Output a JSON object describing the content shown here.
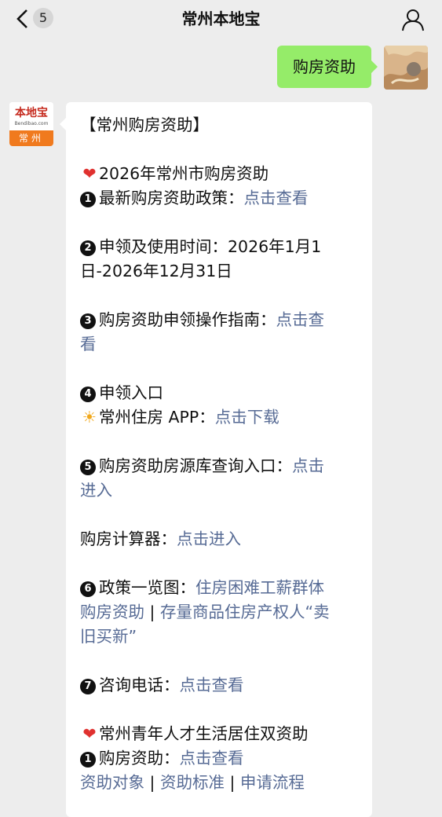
{
  "header": {
    "badge_count": "5",
    "title": "常州本地宝"
  },
  "sent_message": {
    "text": "购房资助"
  },
  "account_avatar": {
    "logo_text": "本地宝",
    "logo_sub": "Bendibao.com",
    "city": "常州"
  },
  "article": {
    "title": "【常州购房资助】",
    "section1_title": "2026年常州市购房资助",
    "item1_label": "最新购房资助政策：",
    "item1_link": "点击查看",
    "item2_line1": "申领及使用时间：2026年1月1",
    "item2_line2": "日-2026年12月31日",
    "item3_label": "购房资助申领操作指南：",
    "item3_link_part1": "点击查",
    "item3_link_part2": "看",
    "item4_label": "申领入口",
    "item4_app_label": "常州住房 APP：",
    "item4_app_link": "点击下载",
    "item5_label": "购房资助房源库查询入口：",
    "item5_link_part1": "点击",
    "item5_link_part2": "进入",
    "calc_label": "购房计算器：",
    "calc_link": "点击进入",
    "item6_label": "政策一览图：",
    "item6_link1_part1": "住房困难工薪群体",
    "item6_link1_part2": "购房资助",
    "sep": " | ",
    "item6_link2_part1": "存量商品住房产权人“卖",
    "item6_link2_part2": "旧买新”",
    "item7_label": "咨询电话：",
    "item7_link": "点击查看",
    "section2_title": "常州青年人才生活居住双资助",
    "s2_item1_label": "购房资助：",
    "s2_item1_link": "点击查看",
    "s2_link_a": "资助对象",
    "s2_link_b": "资助标准",
    "s2_link_c": "申请流程"
  },
  "icons": [
    "back-arrow-icon",
    "user-icon",
    "heart-icon",
    "sun-icon"
  ],
  "colors": {
    "link": "#576b95",
    "sent_bubble": "#95ec69",
    "background": "#ededed",
    "heart": "#e0312f"
  }
}
